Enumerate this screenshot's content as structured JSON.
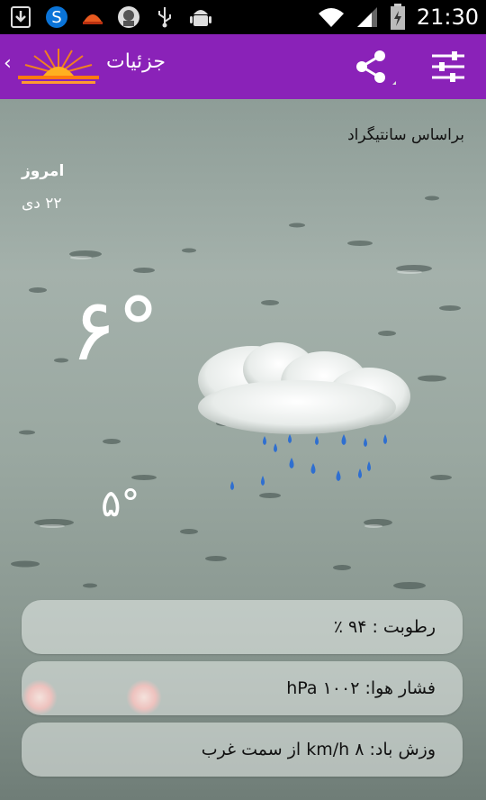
{
  "status_bar": {
    "time": "21:30",
    "icons": [
      "download-icon",
      "s-app-icon",
      "sun-app-icon",
      "avatar-app-icon",
      "usb-icon",
      "android-debug-icon",
      "wifi-icon",
      "signal-icon",
      "battery-icon"
    ]
  },
  "action_bar": {
    "title": "جزئیات",
    "back_glyph": "‹",
    "icons": [
      "sunrise-logo-icon",
      "share-icon",
      "settings-sliders-icon"
    ],
    "color": "#8a22b8"
  },
  "weather": {
    "based_on": "براساس سانتیگراد",
    "day_label": "امروز",
    "day_date": "۲۲ دی",
    "temp_high": "۶°",
    "temp_low": "۵°",
    "condition_icon": "rain-cloud-icon"
  },
  "details": {
    "humidity": "رطوبت : ۹۴ ٪",
    "pressure": "فشار هوا: ۱۰۰۲ hPa",
    "wind": "وزش باد: ۸ km/h از سمت غرب"
  }
}
